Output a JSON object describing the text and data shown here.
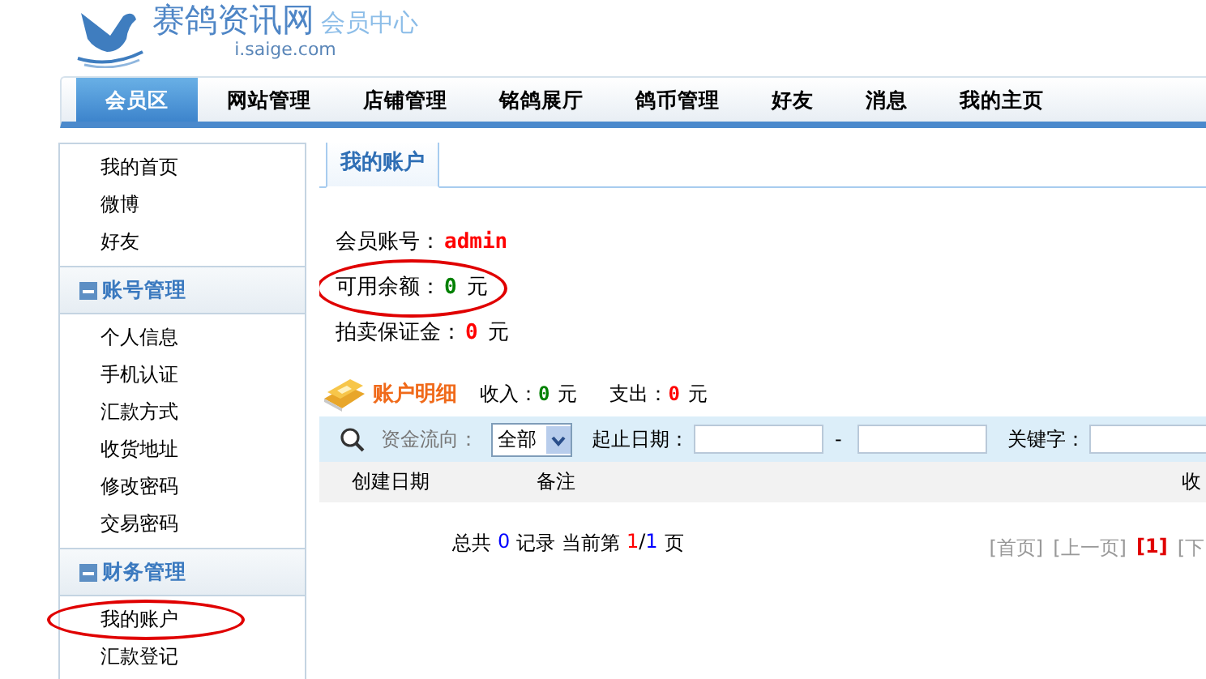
{
  "logo": {
    "name": "赛鸽资讯网",
    "subtitle": "会员中心",
    "domain": "i.saige.com"
  },
  "nav": [
    {
      "label": "会员区",
      "selected": true
    },
    {
      "label": "网站管理",
      "selected": false
    },
    {
      "label": "店铺管理",
      "selected": false
    },
    {
      "label": "铭鸽展厅",
      "selected": false
    },
    {
      "label": "鸽币管理",
      "selected": false
    },
    {
      "label": "好友",
      "selected": false
    },
    {
      "label": "消息",
      "selected": false
    },
    {
      "label": "我的主页",
      "selected": false
    }
  ],
  "sidebar": [
    {
      "items": [
        {
          "label": "我的首页",
          "circled": false
        },
        {
          "label": "微博",
          "circled": false
        },
        {
          "label": "好友",
          "circled": false
        }
      ]
    },
    {
      "title": "账号管理",
      "items": [
        {
          "label": "个人信息",
          "circled": false
        },
        {
          "label": "手机认证",
          "circled": false
        },
        {
          "label": "汇款方式",
          "circled": false
        },
        {
          "label": "收货地址",
          "circled": false
        },
        {
          "label": "修改密码",
          "circled": false
        },
        {
          "label": "交易密码",
          "circled": false
        }
      ]
    },
    {
      "title": "财务管理",
      "items": [
        {
          "label": "我的账户",
          "circled": true
        },
        {
          "label": "汇款登记",
          "circled": false
        }
      ]
    }
  ],
  "tab": "我的账户",
  "account": [
    {
      "label": "会员账号：",
      "value": "admin",
      "color": "#ff0000",
      "circled": false
    },
    {
      "label": "可用余额：",
      "value": "0",
      "unit": "元",
      "color": "#008000",
      "circled": true
    },
    {
      "label": "拍卖保证金：",
      "value": "0",
      "unit": "元",
      "color": "#ff0000",
      "circled": false
    }
  ],
  "details": {
    "title": "账户明细",
    "totals": [
      {
        "label": "收入：",
        "value": "0",
        "unit": "元",
        "color": "#008000"
      },
      {
        "label": "支出：",
        "value": "0",
        "unit": "元",
        "color": "#ff0000"
      }
    ]
  },
  "filter": {
    "direction_label": "资金流向：",
    "direction_value": "全部",
    "date_label": "起止日期：",
    "date_separator": "-",
    "keyword_label": "关键字："
  },
  "table": {
    "columns": [
      "创建日期",
      "备注",
      "收"
    ]
  },
  "summary": {
    "prefix": "总共",
    "count": "0",
    "middle": "记录 当前第",
    "current": "1",
    "separator": "/",
    "total": "1",
    "suffix": "页"
  },
  "pager": [
    {
      "label": "[首页]",
      "selected": false
    },
    {
      "label": "[上一页]",
      "selected": false
    },
    {
      "label": "[1]",
      "selected": true
    },
    {
      "label": "[下",
      "selected": false
    }
  ]
}
